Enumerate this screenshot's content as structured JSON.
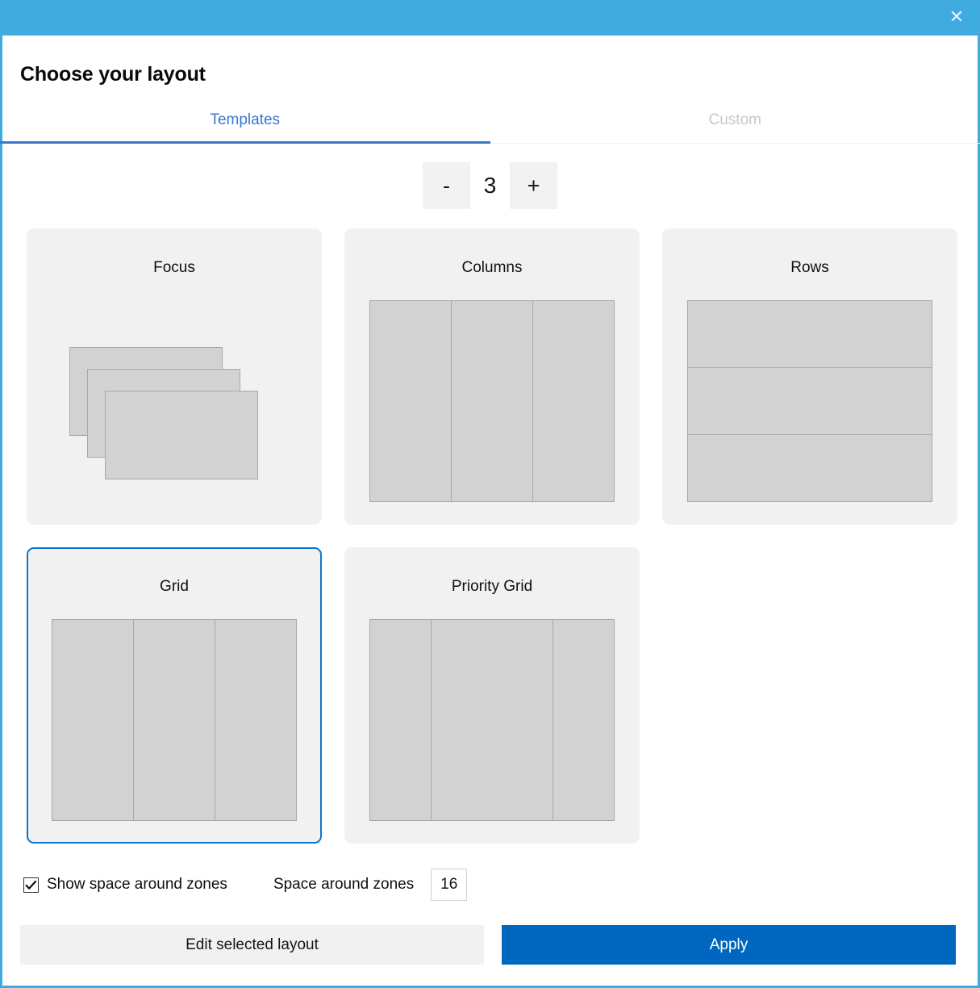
{
  "window": {
    "accent_color": "#3fabdf",
    "close_icon": "close-icon",
    "close_glyph": "✕"
  },
  "header": {
    "title": "Choose your layout"
  },
  "tabs": [
    {
      "label": "Templates",
      "active": true
    },
    {
      "label": "Custom",
      "active": false
    }
  ],
  "stepper": {
    "decrement_label": "-",
    "value": "3",
    "increment_label": "+"
  },
  "templates": [
    {
      "name": "Focus",
      "preview": "cascade",
      "zones": 3,
      "selected": false
    },
    {
      "name": "Columns",
      "preview": "columns",
      "zones": 3,
      "selected": false
    },
    {
      "name": "Rows",
      "preview": "rows",
      "zones": 3,
      "selected": false
    },
    {
      "name": "Grid",
      "preview": "columns",
      "zones": 3,
      "selected": true
    },
    {
      "name": "Priority Grid",
      "preview": "priority",
      "zones": 3,
      "selected": false
    }
  ],
  "options": {
    "show_space_label": "Show space around zones",
    "show_space_checked": true,
    "space_label": "Space around zones",
    "space_value": "16",
    "space_placeholder": "0"
  },
  "footer": {
    "edit_label": "Edit selected layout",
    "apply_label": "Apply",
    "apply_color": "#0067c0"
  }
}
